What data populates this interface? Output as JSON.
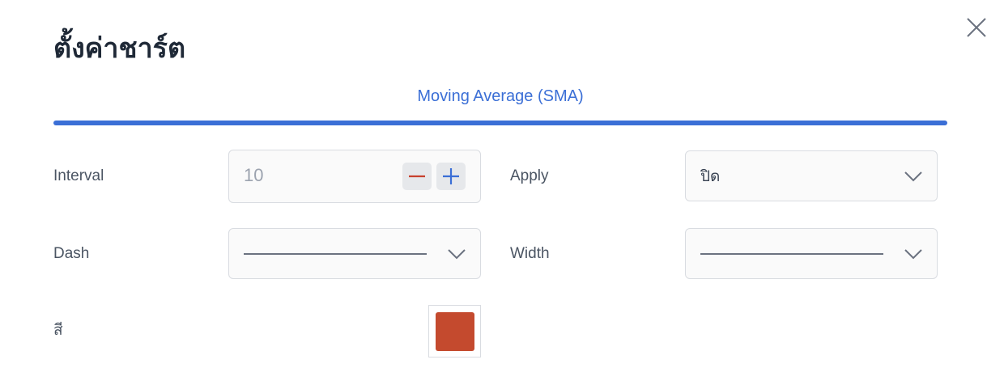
{
  "dialog": {
    "title": "ตั้งค่าชาร์ต",
    "close_icon": "close-icon"
  },
  "tab": {
    "label": "Moving Average (SMA)",
    "accent_color": "#3b6fd6"
  },
  "fields": {
    "interval": {
      "label": "Interval",
      "value": "10",
      "decrement_icon": "minus-icon",
      "increment_icon": "plus-icon"
    },
    "apply": {
      "label": "Apply",
      "value": "ปิด",
      "icon": "chevron-down-icon"
    },
    "dash": {
      "label": "Dash",
      "value_style": "solid-line",
      "icon": "chevron-down-icon"
    },
    "width": {
      "label": "Width",
      "value_style": "solid-line",
      "icon": "chevron-down-icon"
    },
    "color": {
      "label": "สี",
      "value": "#c44a2e"
    }
  }
}
